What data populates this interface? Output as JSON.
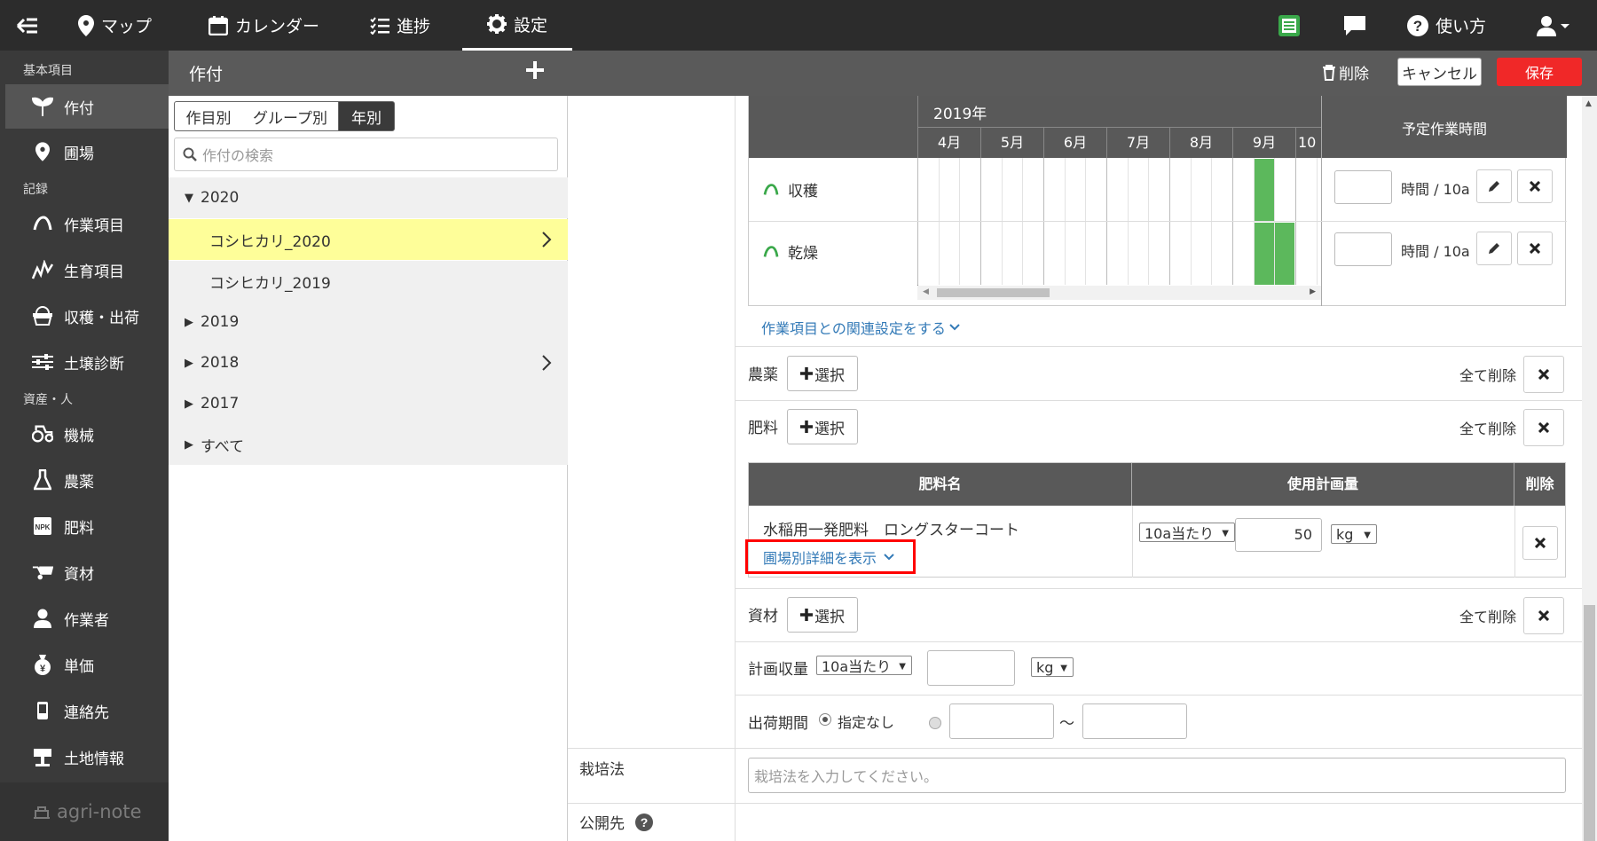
{
  "nav": {
    "map": "マップ",
    "calendar": "カレンダー",
    "progress": "進捗",
    "settings": "設定",
    "help": "使い方"
  },
  "sidebar": {
    "sections": [
      "基本項目",
      "記録",
      "資産・人"
    ],
    "items": [
      {
        "label": "作付",
        "icon": "sprout-icon"
      },
      {
        "label": "圃場",
        "icon": "location-pin-icon"
      },
      {
        "label": "作業項目",
        "icon": "work-item-icon"
      },
      {
        "label": "生育項目",
        "icon": "growth-icon"
      },
      {
        "label": "収穫・出荷",
        "icon": "harvest-basket-icon"
      },
      {
        "label": "土壌診断",
        "icon": "sliders-icon"
      },
      {
        "label": "機械",
        "icon": "tractor-icon"
      },
      {
        "label": "農薬",
        "icon": "flask-icon"
      },
      {
        "label": "肥料",
        "icon": "npk-icon"
      },
      {
        "label": "資材",
        "icon": "wheelbarrow-icon"
      },
      {
        "label": "作業者",
        "icon": "person-icon"
      },
      {
        "label": "単価",
        "icon": "yen-bag-icon"
      },
      {
        "label": "連絡先",
        "icon": "phone-icon"
      },
      {
        "label": "土地情報",
        "icon": "land-sign-icon"
      }
    ],
    "brand": "agri-note"
  },
  "subbar": {
    "title": "作付",
    "delete": "削除",
    "cancel": "キャンセル",
    "save": "保存"
  },
  "list": {
    "tabs": [
      "作目別",
      "グループ別",
      "年別"
    ],
    "active_tab": "年別",
    "search_placeholder": "作付の検索",
    "years": [
      {
        "label": "2020",
        "expanded": true,
        "children": [
          "コシヒカリ_2020",
          "コシヒカリ_2019"
        ]
      },
      {
        "label": "2019"
      },
      {
        "label": "2018"
      },
      {
        "label": "2017"
      },
      {
        "label": "すべて"
      }
    ],
    "selected": "コシヒカリ_2020"
  },
  "schedule": {
    "year": "2019年",
    "months": [
      "4月",
      "5月",
      "6月",
      "7月",
      "8月",
      "9月",
      "10"
    ],
    "planned_header": "予定作業時間",
    "rows": [
      {
        "name": "収穫",
        "unit": "時間 / 10a"
      },
      {
        "name": "乾燥",
        "unit": "時間 / 10a"
      }
    ],
    "relation_link": "作業項目との関連設定をする"
  },
  "pesticide": {
    "label": "農薬",
    "select": "選択",
    "clear_all": "全て削除"
  },
  "fertilizer": {
    "label": "肥料",
    "select": "選択",
    "clear_all": "全て削除",
    "col_name": "肥料名",
    "col_amount": "使用計画量",
    "col_delete": "削除",
    "item": {
      "name": "水稲用一発肥料　ロングスターコート",
      "detail_link": "圃場別詳細を表示",
      "basis": "10a当たり",
      "amount": "50",
      "unit": "kg"
    }
  },
  "material": {
    "label": "資材",
    "select": "選択",
    "clear_all": "全て削除"
  },
  "planned_yield": {
    "label": "計画収量",
    "basis": "10a当たり",
    "unit": "kg"
  },
  "shipping": {
    "label": "出荷期間",
    "option_none": "指定なし",
    "tilde": "〜"
  },
  "cultivation": {
    "label": "栽培法",
    "placeholder": "栽培法を入力してください。"
  },
  "publish": {
    "label": "公開先"
  },
  "colors": {
    "accent_red": "#f02828",
    "bar_green": "#5cb85c",
    "link_blue": "#337ab7",
    "selected_yellow": "#fefe99"
  }
}
